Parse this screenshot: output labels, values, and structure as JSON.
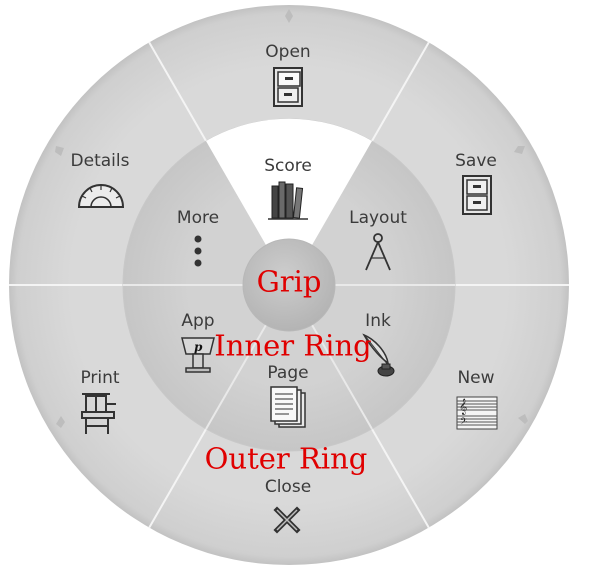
{
  "colors": {
    "outer_ring": "#d6d6d6",
    "inner_ring": "#cfcfcf",
    "selected_segment": "#ffffff",
    "grip": "#c4c4c4",
    "divider": "#f2f2f2",
    "label_text": "#3b3b3b",
    "annotation_text": "#e00000"
  },
  "outer_ring": {
    "items": [
      {
        "label": "Open",
        "icon": "file-cabinet-icon"
      },
      {
        "label": "Save",
        "icon": "file-cabinet-icon"
      },
      {
        "label": "New",
        "icon": "music-staff-icon"
      },
      {
        "label": "Close",
        "icon": "close-x-icon"
      },
      {
        "label": "Print",
        "icon": "printing-press-icon"
      },
      {
        "label": "Details",
        "icon": "protractor-icon"
      }
    ]
  },
  "inner_ring": {
    "selected": "Score",
    "items": [
      {
        "label": "Score",
        "icon": "books-icon"
      },
      {
        "label": "Layout",
        "icon": "compass-icon"
      },
      {
        "label": "Ink",
        "icon": "quill-inkpot-icon"
      },
      {
        "label": "Page",
        "icon": "pages-icon"
      },
      {
        "label": "App",
        "icon": "lectern-icon"
      },
      {
        "label": "More",
        "icon": "vertical-dots-icon"
      }
    ]
  },
  "annotations": {
    "grip": "Grip",
    "inner_ring": "Inner Ring",
    "outer_ring": "Outer Ring"
  },
  "app_icon_letter": "p"
}
